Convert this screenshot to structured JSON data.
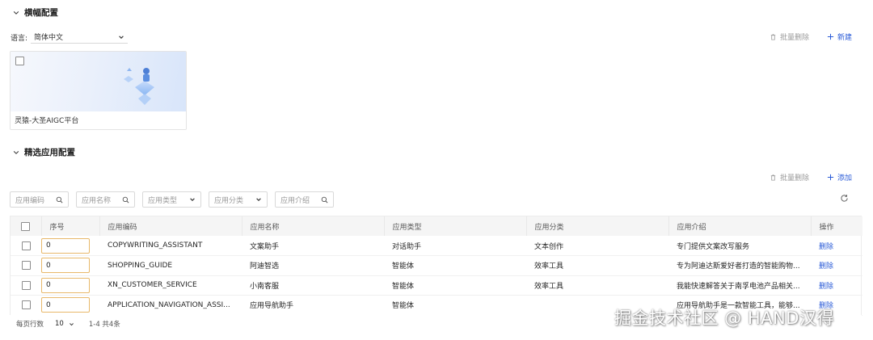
{
  "banner_section": {
    "title": "横幅配置",
    "language_label": "语言:",
    "language_value": "简体中文",
    "batch_delete": "批量删除",
    "create": "新建",
    "cards": [
      {
        "label": "灵猿-大圣AIGC平台"
      }
    ]
  },
  "apps_section": {
    "title": "精选应用配置",
    "batch_delete": "批量删除",
    "add": "添加",
    "filters": {
      "code": "应用编码",
      "name": "应用名称",
      "type": "应用类型",
      "category": "应用分类",
      "intro": "应用介绍"
    },
    "columns": [
      "序号",
      "应用编码",
      "应用名称",
      "应用类型",
      "应用分类",
      "应用介绍",
      "操作"
    ],
    "rows": [
      {
        "seq": "0",
        "code": "COPYWRITING_ASSISTANT",
        "name": "文案助手",
        "type": "对话助手",
        "category": "文本创作",
        "intro": "专门提供文案改写服务",
        "action": "删除"
      },
      {
        "seq": "0",
        "code": "SHOPPING_GUIDE",
        "name": "阿迪智选",
        "type": "智能体",
        "category": "效率工具",
        "intro": "专为阿迪达斯爱好者打造的智能购物...",
        "action": "删除"
      },
      {
        "seq": "0",
        "code": "XN_CUSTOMER_SERVICE",
        "name": "小南客服",
        "type": "智能体",
        "category": "效率工具",
        "intro": "我能快速解答关于南孚电池产品相关...",
        "action": "删除"
      },
      {
        "seq": "0",
        "code": "APPLICATION_NAVIGATION_ASSI...",
        "name": "应用导航助手",
        "type": "智能体",
        "category": "",
        "intro": "应用导航助手是一款智能工具，能够...",
        "action": "删除"
      }
    ],
    "pager": {
      "rows_per_page_label": "每页行数",
      "page_size": "10",
      "range": "1-4 共4条"
    }
  },
  "watermark": "掘金技术社区 @ HAND汉得",
  "colors": {
    "primary": "#2a5bd7",
    "disabled": "#9a9a9a",
    "header_bg": "#f5f5f5",
    "input_border_highlight": "#e8b86a"
  }
}
